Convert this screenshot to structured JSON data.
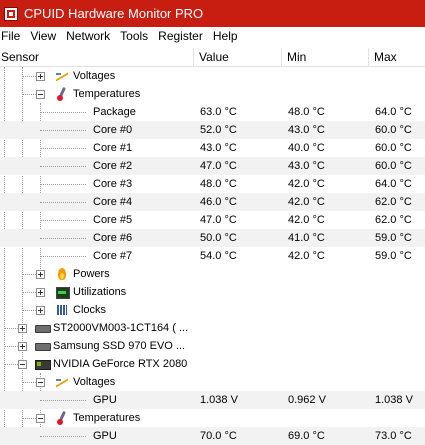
{
  "window": {
    "title": "CPUID Hardware Monitor PRO"
  },
  "menu": [
    "File",
    "View",
    "Network",
    "Tools",
    "Register",
    "Help"
  ],
  "columns": {
    "sensor": "Sensor",
    "value": "Value",
    "min": "Min",
    "max": "Max"
  },
  "tree": [
    {
      "label": "Voltages",
      "icon": "voltage-icon",
      "expander": "plus"
    },
    {
      "label": "Temperatures",
      "icon": "thermometer-icon",
      "expander": "minus"
    },
    {
      "label": "Package",
      "value": "63.0 °C",
      "min": "48.0 °C",
      "max": "64.0 °C"
    },
    {
      "label": "Core #0",
      "value": "52.0 °C",
      "min": "43.0 °C",
      "max": "60.0 °C"
    },
    {
      "label": "Core #1",
      "value": "43.0 °C",
      "min": "40.0 °C",
      "max": "60.0 °C"
    },
    {
      "label": "Core #2",
      "value": "47.0 °C",
      "min": "43.0 °C",
      "max": "60.0 °C"
    },
    {
      "label": "Core #3",
      "value": "48.0 °C",
      "min": "42.0 °C",
      "max": "64.0 °C"
    },
    {
      "label": "Core #4",
      "value": "46.0 °C",
      "min": "42.0 °C",
      "max": "62.0 °C"
    },
    {
      "label": "Core #5",
      "value": "47.0 °C",
      "min": "42.0 °C",
      "max": "62.0 °C"
    },
    {
      "label": "Core #6",
      "value": "50.0 °C",
      "min": "41.0 °C",
      "max": "59.0 °C"
    },
    {
      "label": "Core #7",
      "value": "54.0 °C",
      "min": "42.0 °C",
      "max": "59.0 °C"
    },
    {
      "label": "Powers",
      "icon": "power-flame-icon",
      "expander": "plus"
    },
    {
      "label": "Utilizations",
      "icon": "utilization-chart-icon",
      "expander": "plus"
    },
    {
      "label": "Clocks",
      "icon": "clock-bars-icon",
      "expander": "plus"
    },
    {
      "label": "ST2000VM003-1CT164 ( ...",
      "icon": "hard-disk-icon",
      "expander": "plus"
    },
    {
      "label": "Samsung SSD 970 EVO ...",
      "icon": "ssd-icon",
      "expander": "plus"
    },
    {
      "label": "NVIDIA GeForce RTX 2080",
      "icon": "graphics-card-icon",
      "expander": "minus"
    },
    {
      "label": "Voltages",
      "icon": "voltage-icon",
      "expander": "minus"
    },
    {
      "label": "GPU",
      "value": "1.038 V",
      "min": "0.962 V",
      "max": "1.038 V"
    },
    {
      "label": "Temperatures",
      "icon": "thermometer-icon",
      "expander": "minus"
    },
    {
      "label": "GPU",
      "value": "70.0 °C",
      "min": "69.0 °C",
      "max": "73.0 °C"
    }
  ]
}
